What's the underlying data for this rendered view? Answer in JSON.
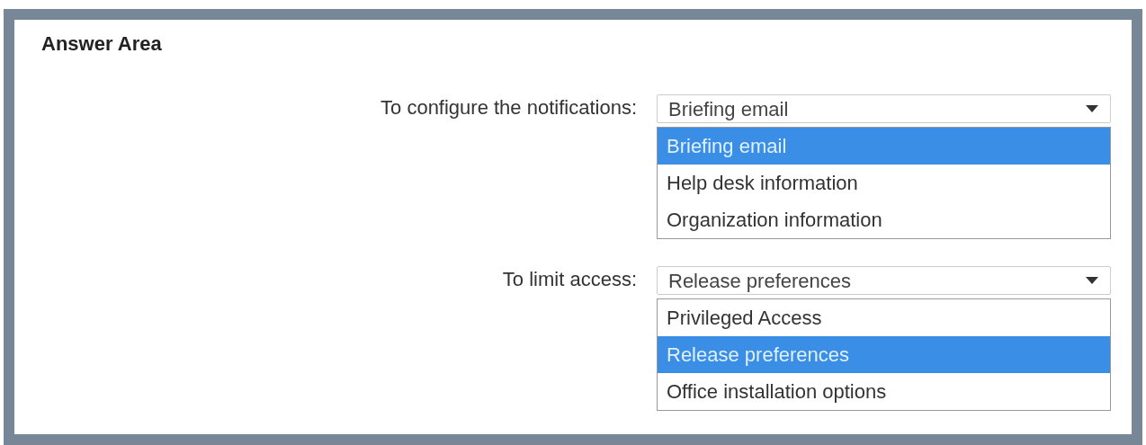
{
  "title": "Answer Area",
  "questions": [
    {
      "label": "To configure the notifications:",
      "value": "Briefing email",
      "options": [
        {
          "label": "Briefing email",
          "selected": true
        },
        {
          "label": "Help desk information",
          "selected": false
        },
        {
          "label": "Organization information",
          "selected": false
        }
      ]
    },
    {
      "label": "To limit access:",
      "value": "Release preferences",
      "options": [
        {
          "label": "Privileged Access",
          "selected": false
        },
        {
          "label": "Release preferences",
          "selected": true
        },
        {
          "label": "Office installation options",
          "selected": false
        }
      ]
    }
  ]
}
